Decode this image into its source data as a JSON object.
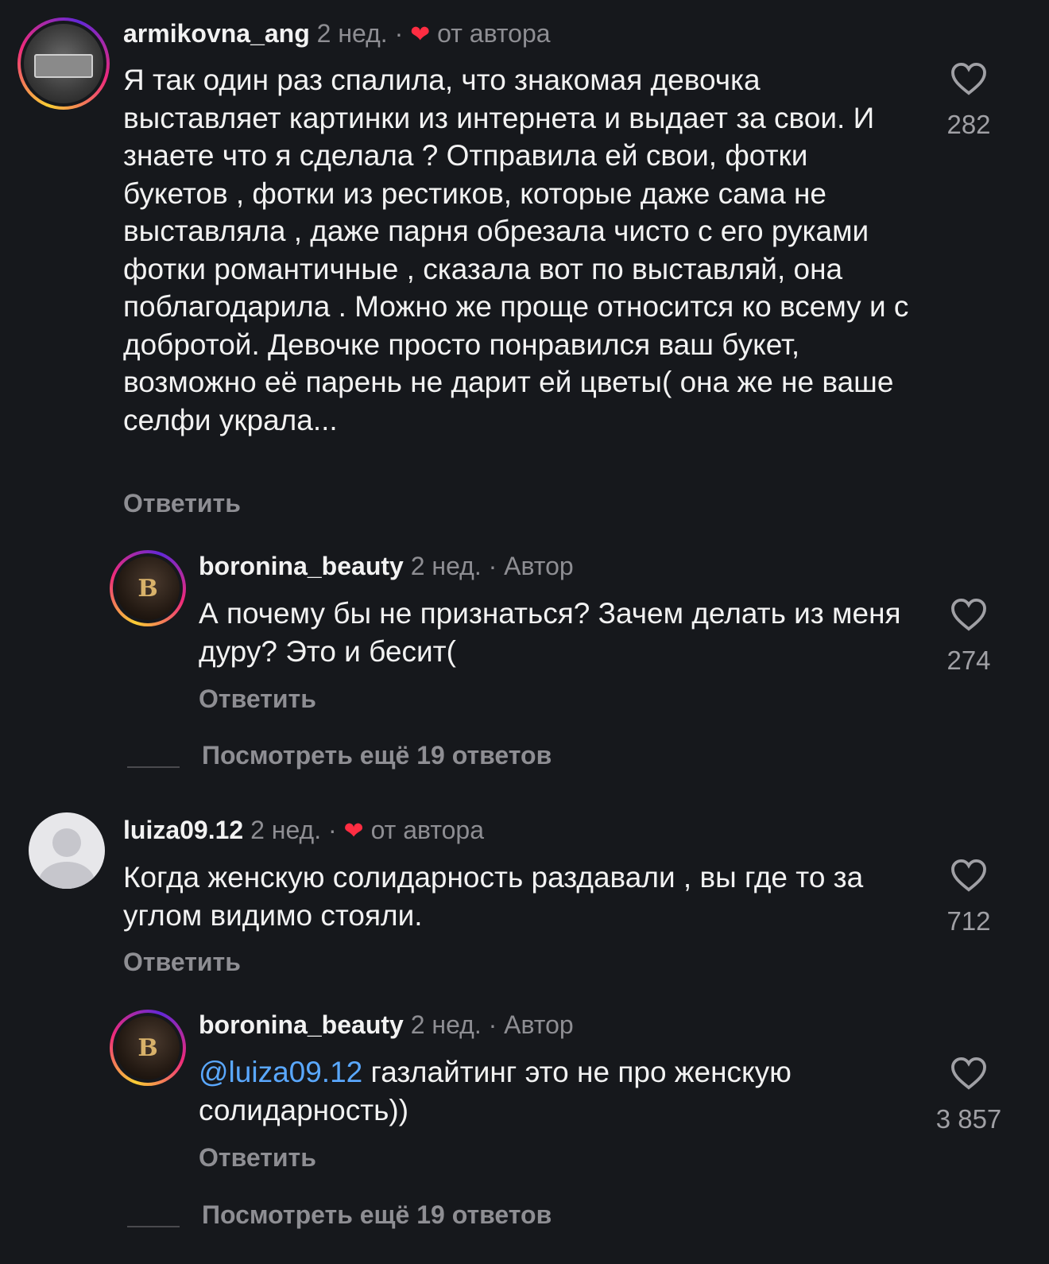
{
  "comments": [
    {
      "username": "armikovna_ang",
      "time": "2 нед.",
      "sep": "·",
      "heart": "❤",
      "badge": "от автора",
      "text": "Я так один раз спалила, что знакомая девочка выставляет картинки из интернета и выдает за свои. И знаете что я сделала ? Отправила ей свои, фотки букетов , фотки из рестиков, которые даже сама не выставляла , даже парня обрезала чисто с его руками фотки романтичные , сказала вот по выставляй, она поблагодарила . Можно же проще относится ко всему и с добротой. Девочке просто понравился ваш букет, возможно её парень не дарит ей цветы(  она же не ваше селфи украла...",
      "reply_label": "Ответить",
      "likes": "282"
    },
    {
      "username": "boronina_beauty",
      "time": "2 нед.",
      "sep": "·",
      "badge": "Автор",
      "text": "А почему бы не признаться? Зачем делать из меня дуру? Это и бесит(",
      "reply_label": "Ответить",
      "likes": "274",
      "avatar_letter": "B"
    },
    {
      "view_more": "Посмотреть ещё 19 ответов"
    },
    {
      "username": "luiza09.12",
      "time": "2 нед.",
      "sep": "·",
      "heart": "❤",
      "badge": "от автора",
      "text": "Когда женскую солидарность раздавали , вы где то за углом видимо стояли.",
      "reply_label": "Ответить",
      "likes": "712"
    },
    {
      "username": "boronina_beauty",
      "time": "2 нед.",
      "sep": "·",
      "badge": "Автор",
      "mention": "@luiza09.12",
      "text": " газлайтинг это не про женскую солидарность))",
      "reply_label": "Ответить",
      "likes": "3 857",
      "avatar_letter": "B"
    },
    {
      "view_more": "Посмотреть ещё 19 ответов"
    }
  ],
  "colors": {
    "background": "#16181c",
    "muted": "#8e8e93",
    "mention": "#5aa8ff",
    "heart": "#ff2d42"
  }
}
